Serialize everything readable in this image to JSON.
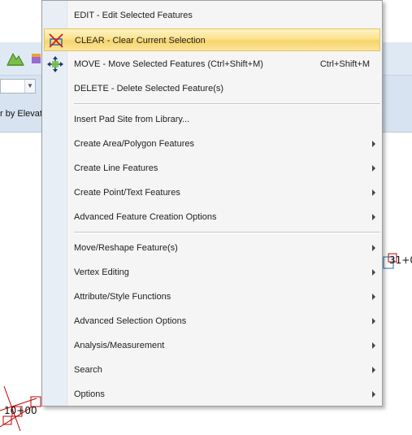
{
  "background": {
    "field_label": "r by Elevat",
    "canvas_labels": [
      "10+00",
      "31+0"
    ]
  },
  "menu": {
    "items": [
      {
        "label": "EDIT - Edit Selected Features"
      },
      {
        "label": "CLEAR - Clear Current Selection",
        "icon": "clear-selection-icon",
        "highlighted": true
      },
      {
        "label": "MOVE - Move Selected Features (Ctrl+Shift+M)",
        "shortcut": "Ctrl+Shift+M",
        "icon": "move-icon"
      },
      {
        "label": "DELETE - Delete Selected Feature(s)"
      },
      {
        "label": "Insert Pad Site from Library..."
      },
      {
        "label": "Create Area/Polygon Features",
        "submenu": true
      },
      {
        "label": "Create Line Features",
        "submenu": true
      },
      {
        "label": "Create Point/Text Features",
        "submenu": true
      },
      {
        "label": "Advanced Feature Creation Options",
        "submenu": true
      },
      {
        "label": "Move/Reshape Feature(s)",
        "submenu": true
      },
      {
        "label": "Vertex Editing",
        "submenu": true
      },
      {
        "label": "Attribute/Style Functions",
        "submenu": true
      },
      {
        "label": "Advanced Selection Options",
        "submenu": true
      },
      {
        "label": "Analysis/Measurement",
        "submenu": true
      },
      {
        "label": "Search",
        "submenu": true
      },
      {
        "label": "Options",
        "submenu": true
      }
    ]
  },
  "colors": {
    "highlight": "#fbe38f",
    "menu_bg": "#f5f5f5",
    "toolbar_bg": "#d7e3f0"
  }
}
